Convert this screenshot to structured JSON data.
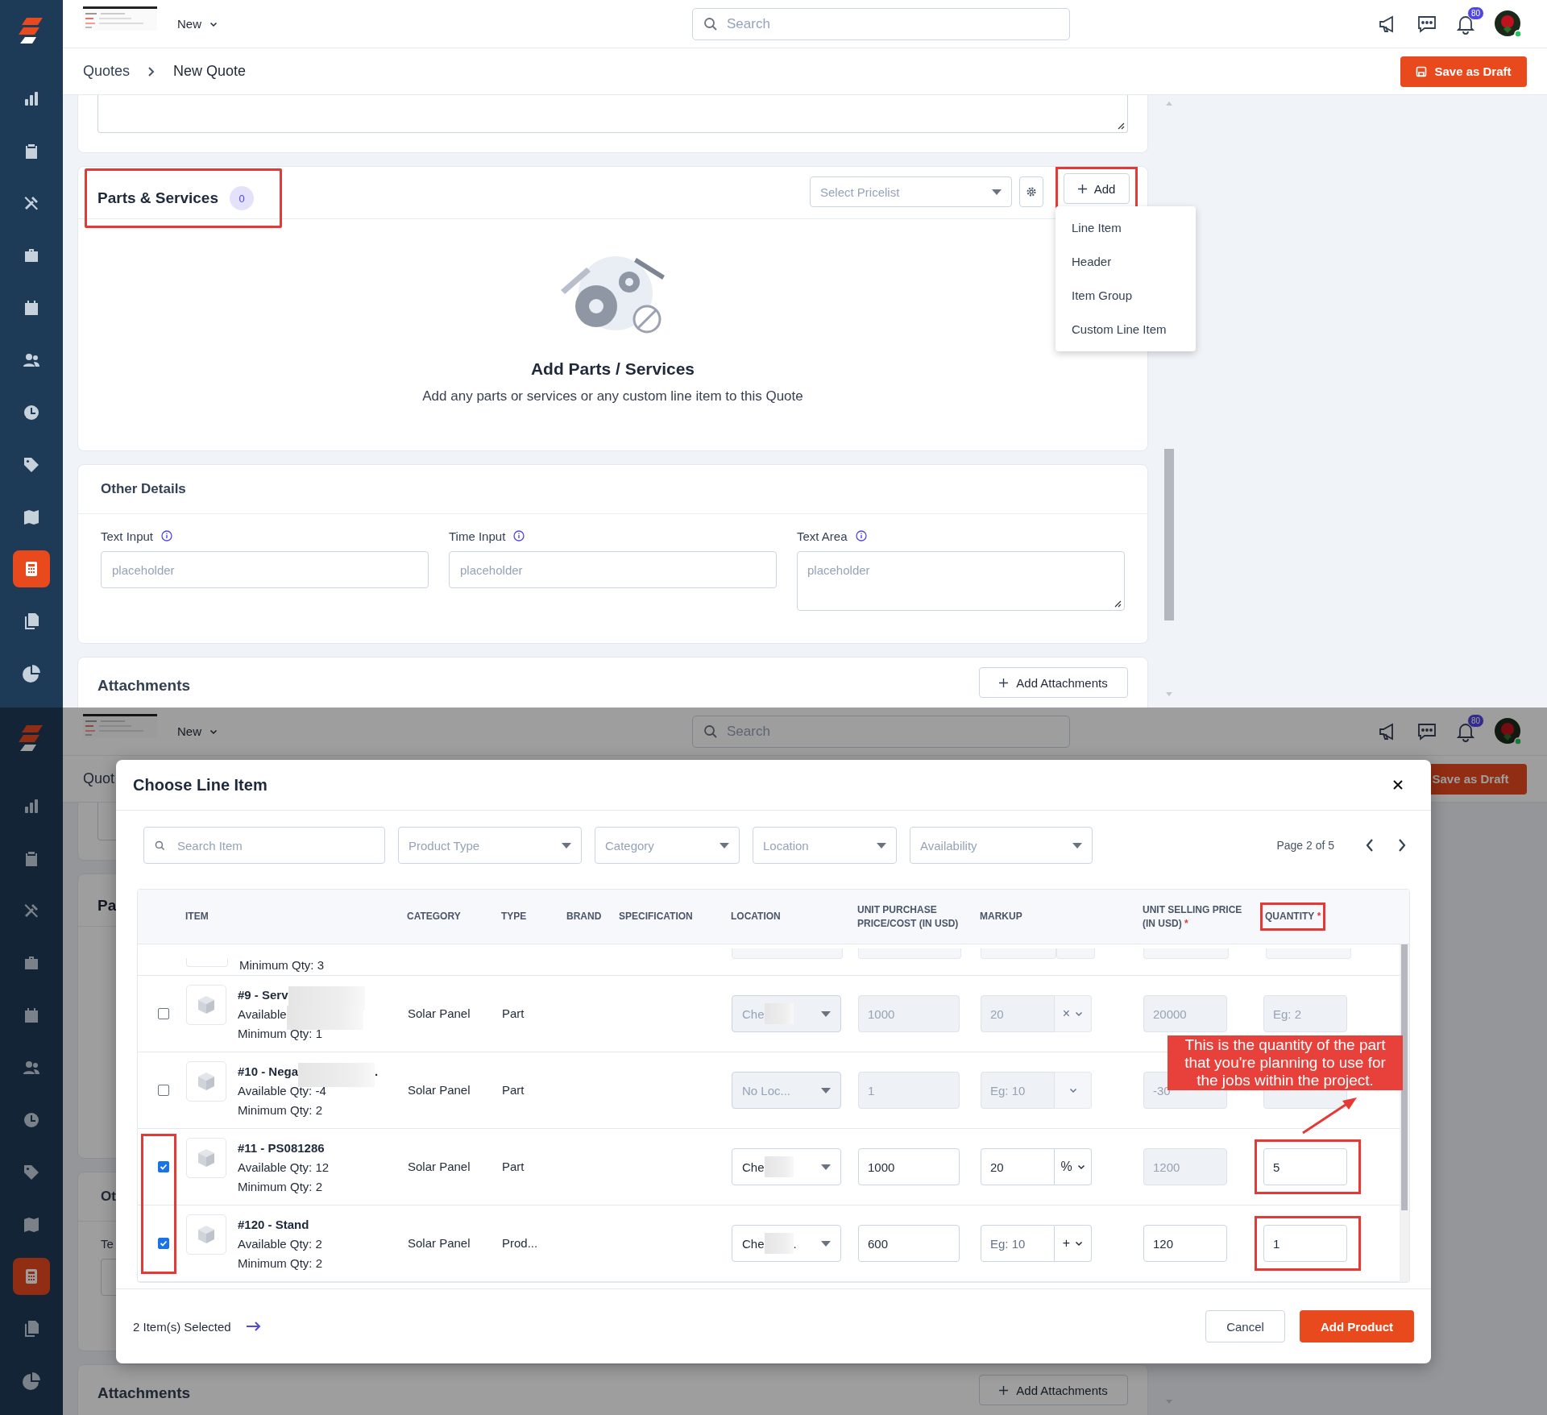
{
  "page_view": {
    "sidebar": {
      "items": [
        {
          "selected": false
        },
        {
          "selected": false
        },
        {
          "selected": false
        },
        {
          "selected": false
        },
        {
          "selected": false
        },
        {
          "selected": false
        },
        {
          "selected": false
        },
        {
          "selected": false
        },
        {
          "selected": false
        },
        {
          "selected": true
        },
        {
          "selected": false
        },
        {
          "selected": false
        }
      ]
    },
    "topbar": {
      "menu_label": "New",
      "search_placeholder": "Search",
      "notification_count": "80"
    },
    "breadcrumb": [
      "Quotes",
      "New Quote"
    ],
    "save_button": "Save as Draft",
    "parts": {
      "title": "Parts & Services",
      "highlighted": true,
      "count": "0",
      "pricelist_placeholder": "Select Pricelist",
      "add_button": {
        "label": "Add",
        "highlighted": true
      },
      "menu": [
        "Line Item",
        "Header",
        "Item Group",
        "Custom Line Item"
      ],
      "empty_title": "Add Parts / Services",
      "empty_text": "Add any parts or services or any custom line item to this Quote"
    },
    "other_details": {
      "title": "Other Details",
      "fields": [
        {
          "kind": "input",
          "label": "Text Input",
          "info": true,
          "placeholder": "placeholder"
        },
        {
          "kind": "input",
          "label": "Time Input",
          "info": true,
          "placeholder": "placeholder"
        },
        {
          "kind": "textarea",
          "label": "Text Area",
          "info": true,
          "placeholder": "placeholder"
        }
      ]
    },
    "attachments": {
      "title": "Attachments",
      "button": "Add Attachments"
    }
  },
  "modal_view": {
    "sidebar": {
      "items": [
        {
          "selected": false
        },
        {
          "selected": false
        },
        {
          "selected": false
        },
        {
          "selected": false
        },
        {
          "selected": false
        },
        {
          "selected": false
        },
        {
          "selected": false
        },
        {
          "selected": false
        },
        {
          "selected": false
        },
        {
          "selected": true
        },
        {
          "selected": false
        },
        {
          "selected": false
        }
      ]
    },
    "topbar": {
      "menu_label": "New",
      "search_placeholder": "Search",
      "notification_count": "80"
    },
    "breadcrumb": [
      "Quot"
    ],
    "save_button": "Save as Draft",
    "parts": {
      "title": "Pa",
      "highlighted": false
    },
    "other_details": {
      "title": "Ot",
      "fields": [
        {
          "kind": "input",
          "label": "Te",
          "info": false
        }
      ]
    },
    "attachments": {
      "title": "Attachments",
      "button": "Add Attachments"
    },
    "modal": {
      "title": "Choose Line Item",
      "search_placeholder": "Search Item",
      "filters": [
        "Product Type",
        "Category",
        "Location",
        "Availability"
      ],
      "page": "Page 2 of 5",
      "columns": [
        {
          "label": "ITEM"
        },
        {
          "label": "CATEGORY"
        },
        {
          "label": "TYPE"
        },
        {
          "label": "BRAND"
        },
        {
          "label": "SPECIFICATION"
        },
        {
          "label": "LOCATION"
        },
        {
          "label": "UNIT PURCHASE PRICE/COST (IN USD)"
        },
        {
          "label": "MARKUP"
        },
        {
          "label": "UNIT SELLING PRICE (IN USD)",
          "required_mark": "*"
        },
        {
          "label": "QUANTITY",
          "required_mark": "*",
          "highlighted": true
        }
      ],
      "partial_row": {
        "minimum": "Minimum Qty: 3"
      },
      "rows": [
        {
          "selected": false,
          "highlighted": false,
          "title": [
            {
              "kind": "text",
              "text": "#9 - Serv"
            },
            {
              "kind": "redaction"
            }
          ],
          "available": [
            {
              "kind": "text",
              "text": "Available"
            },
            {
              "kind": "redaction"
            }
          ],
          "minimum": "Minimum Qty: 1",
          "category": "Solar Panel",
          "type": "Part",
          "location": {
            "disabled": true,
            "parts": [
              {
                "kind": "text",
                "text": "Che"
              },
              {
                "kind": "redaction"
              }
            ]
          },
          "purchase": {
            "value": "1000",
            "disabled": true
          },
          "markup": {
            "value": "20",
            "unit": "×",
            "disabled": true
          },
          "selling": {
            "value": "20000",
            "disabled": true
          },
          "quantity": {
            "placeholder": "Eg: 2",
            "disabled": true,
            "highlighted": false
          }
        },
        {
          "selected": false,
          "highlighted": false,
          "title": [
            {
              "kind": "text",
              "text": "#10 - Nega"
            },
            {
              "kind": "redaction"
            },
            {
              "kind": "text",
              "text": "."
            }
          ],
          "available": [
            {
              "kind": "text",
              "text": "Available Qty: -4"
            }
          ],
          "minimum": "Minimum Qty: 2",
          "category": "Solar Panel",
          "type": "Part",
          "location": {
            "disabled": true,
            "parts": [
              {
                "kind": "text",
                "text": "No Loc..."
              }
            ]
          },
          "purchase": {
            "value": "1",
            "disabled": true
          },
          "markup": {
            "placeholder": "Eg: 10",
            "disabled": true
          },
          "selling": {
            "value": "-30",
            "disabled": true
          },
          "quantity": {
            "disabled": true,
            "highlighted": false
          }
        },
        {
          "selected": true,
          "highlighted": true,
          "title": [
            {
              "kind": "text",
              "text": "#11 - PS081286"
            }
          ],
          "available": [
            {
              "kind": "text",
              "text": "Available Qty: 12"
            }
          ],
          "minimum": "Minimum Qty: 2",
          "category": "Solar Panel",
          "type": "Part",
          "location": {
            "disabled": false,
            "parts": [
              {
                "kind": "text",
                "text": "Che"
              },
              {
                "kind": "redaction"
              }
            ]
          },
          "purchase": {
            "value": "1000",
            "disabled": false
          },
          "markup": {
            "value": "20",
            "unit": "%",
            "disabled": false
          },
          "selling": {
            "value": "1200",
            "disabled": true
          },
          "quantity": {
            "value": "5",
            "disabled": false,
            "highlighted": true
          }
        },
        {
          "selected": true,
          "highlighted": true,
          "title": [
            {
              "kind": "text",
              "text": "#120 - Stand"
            }
          ],
          "available": [
            {
              "kind": "text",
              "text": "Available Qty: 2"
            }
          ],
          "minimum": "Minimum Qty: 2",
          "category": "Solar Panel",
          "type": "Prod...",
          "location": {
            "disabled": false,
            "parts": [
              {
                "kind": "text",
                "text": "Che"
              },
              {
                "kind": "redaction"
              },
              {
                "kind": "text",
                "text": "."
              }
            ]
          },
          "purchase": {
            "value": "600",
            "disabled": false
          },
          "markup": {
            "placeholder": "Eg: 10",
            "unit": "+",
            "disabled": false
          },
          "selling": {
            "value": "120",
            "disabled": false
          },
          "quantity": {
            "value": "1",
            "disabled": false,
            "highlighted": true
          }
        }
      ],
      "annotation": "This is the quantity of the part that you're planning to use for the jobs within the project.",
      "selected_count": "2 Item(s) Selected",
      "cancel": "Cancel",
      "confirm": "Add Product"
    }
  }
}
